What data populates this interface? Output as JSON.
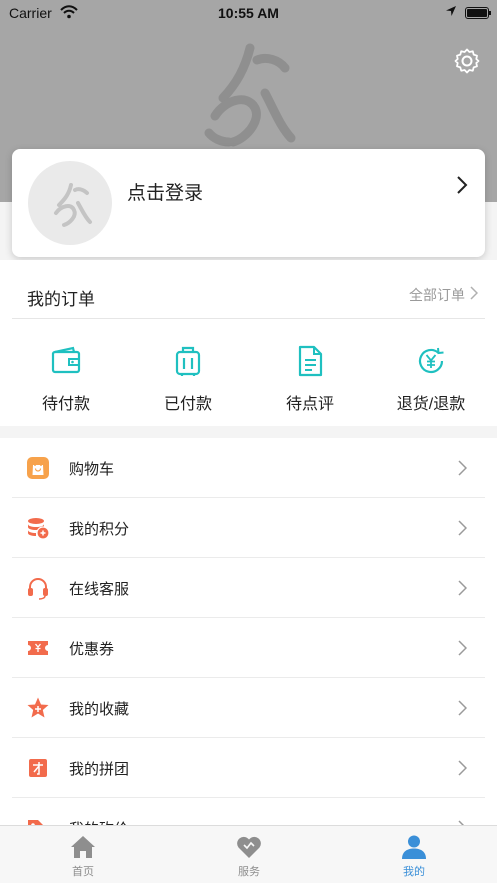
{
  "status_bar": {
    "carrier": "Carrier",
    "time": "10:55 AM"
  },
  "login": {
    "prompt": "点击登录"
  },
  "orders": {
    "title": "我的订单",
    "all_label": "全部订单",
    "items": [
      {
        "label": "待付款",
        "icon": "wallet-icon"
      },
      {
        "label": "已付款",
        "icon": "luggage-icon"
      },
      {
        "label": "待点评",
        "icon": "document-icon"
      },
      {
        "label": "退货/退款",
        "icon": "yen-refund-icon"
      }
    ]
  },
  "menu": {
    "items": [
      {
        "label": "购物车",
        "icon": "shopping-bag-icon"
      },
      {
        "label": "我的积分",
        "icon": "coins-icon"
      },
      {
        "label": "在线客服",
        "icon": "headset-icon"
      },
      {
        "label": "优惠券",
        "icon": "coupon-icon"
      },
      {
        "label": "我的收藏",
        "icon": "star-icon"
      },
      {
        "label": "我的拼团",
        "icon": "group-buy-icon"
      },
      {
        "label": "我的砍价",
        "icon": "bargain-tag-icon"
      }
    ]
  },
  "tabbar": {
    "items": [
      {
        "label": "首页",
        "icon": "home-icon"
      },
      {
        "label": "服务",
        "icon": "heart-icon"
      },
      {
        "label": "我的",
        "icon": "person-icon"
      }
    ],
    "active_index": 2
  },
  "colors": {
    "accent": "#1fc0c0",
    "menu_icon_orange": "#f26b4c",
    "tab_active": "#3a8fd8",
    "header_bg": "#a6a6a6"
  }
}
